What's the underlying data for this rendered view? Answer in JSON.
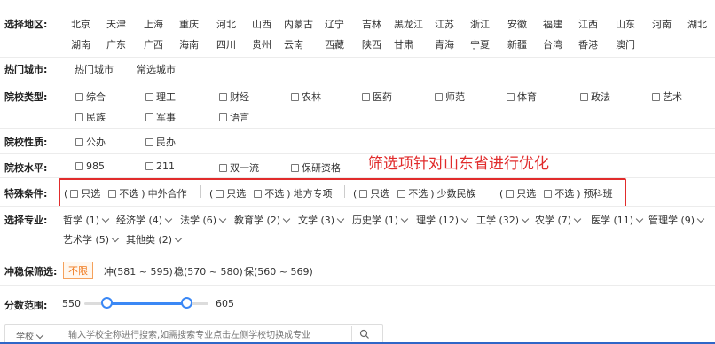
{
  "region": {
    "label": "选择地区:",
    "row1": [
      "北京",
      "天津",
      "上海",
      "重庆",
      "河北",
      "山西",
      "内蒙古",
      "辽宁",
      "吉林",
      "黑龙江",
      "江苏",
      "浙江",
      "安徽",
      "福建",
      "江西",
      "山东",
      "河南",
      "湖北"
    ],
    "row2": [
      "湖南",
      "广东",
      "广西",
      "海南",
      "四川",
      "贵州",
      "云南",
      "西藏",
      "陕西",
      "甘肃",
      "青海",
      "宁夏",
      "新疆",
      "台湾",
      "香港",
      "澳门"
    ]
  },
  "hot_city": {
    "label": "热门城市:",
    "tabs": [
      "热门城市",
      "常选城市"
    ]
  },
  "school_type": {
    "label": "院校类型:",
    "options": [
      "综合",
      "理工",
      "财经",
      "农林",
      "医药",
      "师范",
      "体育",
      "政法",
      "艺术",
      "民族",
      "军事",
      "语言"
    ]
  },
  "school_nature": {
    "label": "院校性质:",
    "options": [
      "公办",
      "民办"
    ]
  },
  "school_level": {
    "label": "院校水平:",
    "options": [
      "985",
      "211",
      "双一流",
      "保研资格"
    ]
  },
  "annotation": "筛选项针对山东省进行优化",
  "special": {
    "label": "特殊条件:",
    "groups": [
      {
        "only": "只选",
        "exclude": "不选",
        "name": "中外合作"
      },
      {
        "only": "只选",
        "exclude": "不选",
        "name": "地方专项"
      },
      {
        "only": "只选",
        "exclude": "不选",
        "name": "少数民族"
      },
      {
        "only": "只选",
        "exclude": "不选",
        "name": "预科班"
      }
    ]
  },
  "major": {
    "label": "选择专业:",
    "row1": [
      "哲学 (1)",
      "经济学 (4)",
      "法学 (6)",
      "教育学 (2)",
      "文学 (3)",
      "历史学 (1)",
      "理学 (12)",
      "工学 (32)",
      "农学 (7)",
      "医学 (11)",
      "管理学 (9)"
    ],
    "row2": [
      "艺术学 (5)",
      "其他类 (2)"
    ]
  },
  "risk": {
    "label": "冲稳保筛选:",
    "selected": "不限",
    "options": [
      "冲(581 ~ 595)",
      "稳(570 ~ 580)",
      "保(560 ~ 569)"
    ]
  },
  "score": {
    "label": "分数范围:",
    "min": "550",
    "max": "605"
  },
  "search": {
    "prefix": "学校",
    "placeholder": "输入学校全称进行搜索,如需搜索专业点击左侧学校切换成专业"
  },
  "colors": {
    "accent": "#3b88f5",
    "annotation": "#e12c2c",
    "pill": "#f07b20"
  }
}
